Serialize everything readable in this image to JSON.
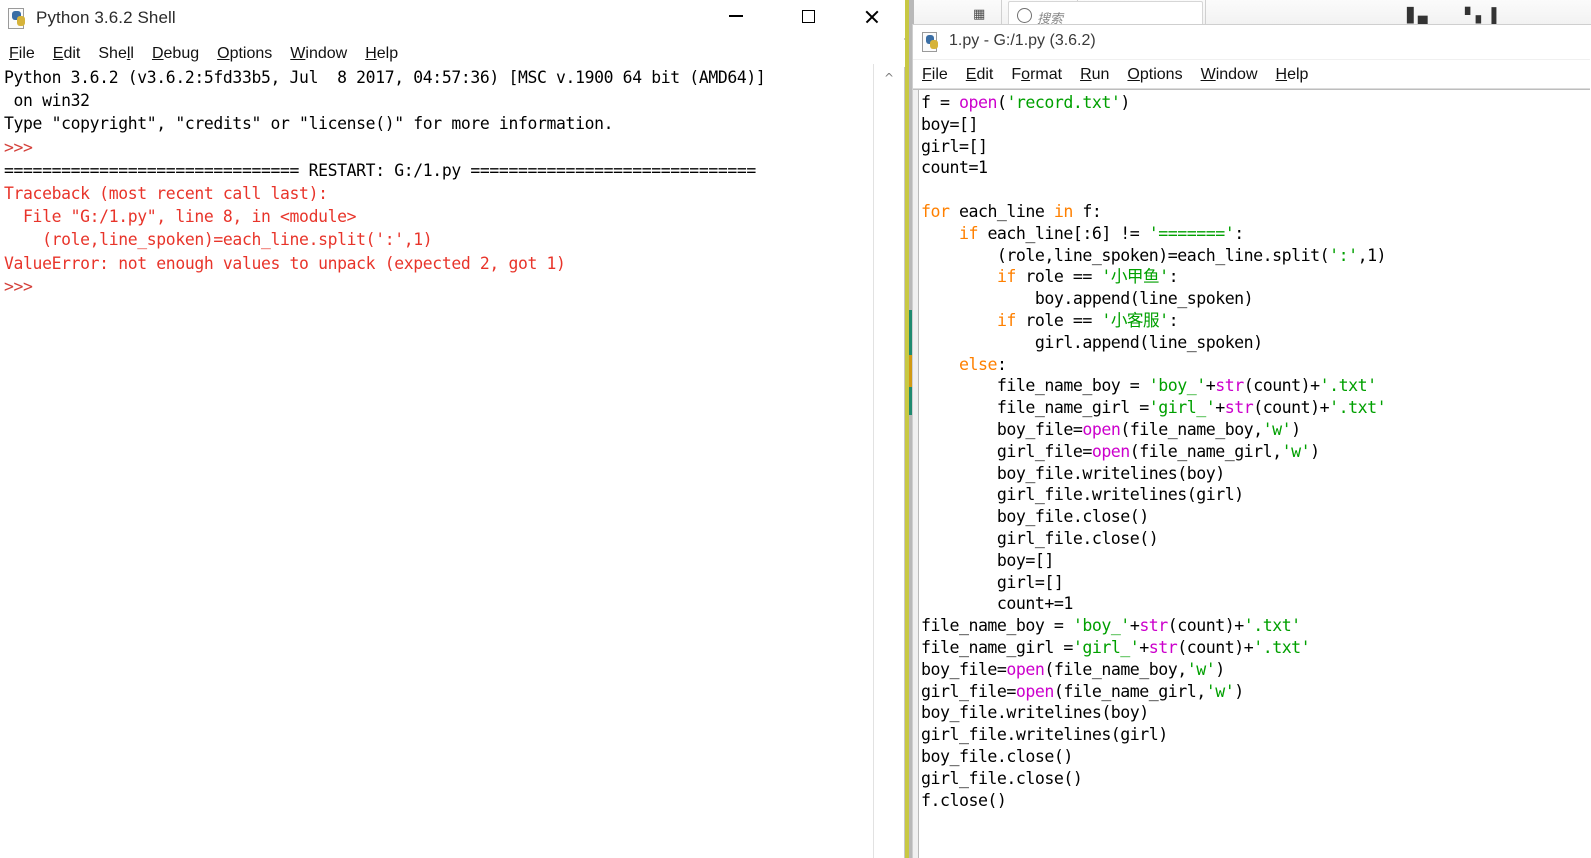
{
  "background_window": {
    "search_placeholder": "搜索",
    "icons": [
      "calculator-icon",
      "ellipsis-icon",
      "person-icon",
      "search-icon",
      "chart-icon",
      "bars-icon"
    ]
  },
  "shell_window": {
    "title": "Python 3.6.2 Shell",
    "app_icon": "python-icon",
    "window_buttons": {
      "minimize": "minimize-icon",
      "maximize": "maximize-icon",
      "close": "close-icon"
    },
    "menu": [
      {
        "label": "File",
        "mnemonic": "F"
      },
      {
        "label": "Edit",
        "mnemonic": "E"
      },
      {
        "label": "Shell",
        "mnemonic": "l"
      },
      {
        "label": "Debug",
        "mnemonic": "D"
      },
      {
        "label": "Options",
        "mnemonic": "O"
      },
      {
        "label": "Window",
        "mnemonic": "W"
      },
      {
        "label": "Help",
        "mnemonic": "H"
      }
    ],
    "scrollbar": {
      "up_arrow": "chevron-up-icon"
    },
    "output_lines": [
      {
        "text": "Python 3.6.2 (v3.6.2:5fd33b5, Jul  8 2017, 04:57:36) [MSC v.1900 64 bit (AMD64)]",
        "style": "plain"
      },
      {
        "text": " on win32",
        "style": "plain"
      },
      {
        "text": "Type \"copyright\", \"credits\" or \"license()\" for more information.",
        "style": "plain"
      },
      {
        "text": ">>>",
        "style": "prompt"
      },
      {
        "text": "=============================== RESTART: G:/1.py ==============================",
        "style": "plain"
      },
      {
        "text": "Traceback (most recent call last):",
        "style": "error"
      },
      {
        "text": "  File \"G:/1.py\", line 8, in <module>",
        "style": "error"
      },
      {
        "text": "    (role,line_spoken)=each_line.split(':',1)",
        "style": "error"
      },
      {
        "text": "ValueError: not enough values to unpack (expected 2, got 1)",
        "style": "error"
      },
      {
        "text": ">>>",
        "style": "prompt"
      }
    ]
  },
  "editor_window": {
    "title": "1.py - G:/1.py (3.6.2)",
    "app_icon": "python-icon",
    "menu": [
      {
        "label": "File",
        "mnemonic": "F"
      },
      {
        "label": "Edit",
        "mnemonic": "E"
      },
      {
        "label": "Format",
        "mnemonic": "o"
      },
      {
        "label": "Run",
        "mnemonic": "R"
      },
      {
        "label": "Options",
        "mnemonic": "O"
      },
      {
        "label": "Window",
        "mnemonic": "W"
      },
      {
        "label": "Help",
        "mnemonic": "H"
      }
    ],
    "code_lines": [
      [
        {
          "t": "f = ",
          "c": ""
        },
        {
          "t": "open",
          "c": "b"
        },
        {
          "t": "(",
          "c": ""
        },
        {
          "t": "'record.txt'",
          "c": "s"
        },
        {
          "t": ")",
          "c": ""
        }
      ],
      [
        {
          "t": "boy=[]",
          "c": ""
        }
      ],
      [
        {
          "t": "girl=[]",
          "c": ""
        }
      ],
      [
        {
          "t": "count=1",
          "c": ""
        }
      ],
      [
        {
          "t": "",
          "c": ""
        }
      ],
      [
        {
          "t": "for",
          "c": "k"
        },
        {
          "t": " each_line ",
          "c": ""
        },
        {
          "t": "in",
          "c": "k"
        },
        {
          "t": " f:",
          "c": ""
        }
      ],
      [
        {
          "t": "    ",
          "c": ""
        },
        {
          "t": "if",
          "c": "k"
        },
        {
          "t": " each_line[:6] != ",
          "c": ""
        },
        {
          "t": "'======='",
          "c": "s"
        },
        {
          "t": ":",
          "c": ""
        }
      ],
      [
        {
          "t": "        (role,line_spoken)=each_line.split(",
          "c": ""
        },
        {
          "t": "':'",
          "c": "s"
        },
        {
          "t": ",1)",
          "c": ""
        }
      ],
      [
        {
          "t": "        ",
          "c": ""
        },
        {
          "t": "if",
          "c": "k"
        },
        {
          "t": " role == ",
          "c": ""
        },
        {
          "t": "'小甲鱼'",
          "c": "s"
        },
        {
          "t": ":",
          "c": ""
        }
      ],
      [
        {
          "t": "            boy.append(line_spoken)",
          "c": ""
        }
      ],
      [
        {
          "t": "        ",
          "c": ""
        },
        {
          "t": "if",
          "c": "k"
        },
        {
          "t": " role == ",
          "c": ""
        },
        {
          "t": "'小客服'",
          "c": "s"
        },
        {
          "t": ":",
          "c": ""
        }
      ],
      [
        {
          "t": "            girl.append(line_spoken)",
          "c": ""
        }
      ],
      [
        {
          "t": "    ",
          "c": ""
        },
        {
          "t": "else",
          "c": "k"
        },
        {
          "t": ":",
          "c": ""
        }
      ],
      [
        {
          "t": "        file_name_boy = ",
          "c": ""
        },
        {
          "t": "'boy_'",
          "c": "s"
        },
        {
          "t": "+",
          "c": ""
        },
        {
          "t": "str",
          "c": "b"
        },
        {
          "t": "(count)+",
          "c": ""
        },
        {
          "t": "'.txt'",
          "c": "s"
        }
      ],
      [
        {
          "t": "        file_name_girl =",
          "c": ""
        },
        {
          "t": "'girl_'",
          "c": "s"
        },
        {
          "t": "+",
          "c": ""
        },
        {
          "t": "str",
          "c": "b"
        },
        {
          "t": "(count)+",
          "c": ""
        },
        {
          "t": "'.txt'",
          "c": "s"
        }
      ],
      [
        {
          "t": "        boy_file=",
          "c": ""
        },
        {
          "t": "open",
          "c": "b"
        },
        {
          "t": "(file_name_boy,",
          "c": ""
        },
        {
          "t": "'w'",
          "c": "s"
        },
        {
          "t": ")",
          "c": ""
        }
      ],
      [
        {
          "t": "        girl_file=",
          "c": ""
        },
        {
          "t": "open",
          "c": "b"
        },
        {
          "t": "(file_name_girl,",
          "c": ""
        },
        {
          "t": "'w'",
          "c": "s"
        },
        {
          "t": ")",
          "c": ""
        }
      ],
      [
        {
          "t": "        boy_file.writelines(boy)",
          "c": ""
        }
      ],
      [
        {
          "t": "        girl_file.writelines(girl)",
          "c": ""
        }
      ],
      [
        {
          "t": "        boy_file.close()",
          "c": ""
        }
      ],
      [
        {
          "t": "        girl_file.close()",
          "c": ""
        }
      ],
      [
        {
          "t": "        boy=[]",
          "c": ""
        }
      ],
      [
        {
          "t": "        girl=[]",
          "c": ""
        }
      ],
      [
        {
          "t": "        count+=1",
          "c": ""
        }
      ],
      [
        {
          "t": "file_name_boy = ",
          "c": ""
        },
        {
          "t": "'boy_'",
          "c": "s"
        },
        {
          "t": "+",
          "c": ""
        },
        {
          "t": "str",
          "c": "b"
        },
        {
          "t": "(count)+",
          "c": ""
        },
        {
          "t": "'.txt'",
          "c": "s"
        }
      ],
      [
        {
          "t": "file_name_girl =",
          "c": ""
        },
        {
          "t": "'girl_'",
          "c": "s"
        },
        {
          "t": "+",
          "c": ""
        },
        {
          "t": "str",
          "c": "b"
        },
        {
          "t": "(count)+",
          "c": ""
        },
        {
          "t": "'.txt'",
          "c": "s"
        }
      ],
      [
        {
          "t": "boy_file=",
          "c": ""
        },
        {
          "t": "open",
          "c": "b"
        },
        {
          "t": "(file_name_boy,",
          "c": ""
        },
        {
          "t": "'w'",
          "c": "s"
        },
        {
          "t": ")",
          "c": ""
        }
      ],
      [
        {
          "t": "girl_file=",
          "c": ""
        },
        {
          "t": "open",
          "c": "b"
        },
        {
          "t": "(file_name_girl,",
          "c": ""
        },
        {
          "t": "'w'",
          "c": "s"
        },
        {
          "t": ")",
          "c": ""
        }
      ],
      [
        {
          "t": "boy_file.writelines(boy)",
          "c": ""
        }
      ],
      [
        {
          "t": "girl_file.writelines(girl)",
          "c": ""
        }
      ],
      [
        {
          "t": "boy_file.close()",
          "c": ""
        }
      ],
      [
        {
          "t": "girl_file.close()",
          "c": ""
        }
      ],
      [
        {
          "t": "f.close()",
          "c": ""
        }
      ]
    ]
  },
  "colors": {
    "keyword": "#ff8000",
    "builtin": "#cc00cc",
    "string": "#00a000",
    "error": "#e8342a",
    "prompt": "#d4403a",
    "rail_yellow": "#c8c843",
    "rail_green": "#1f8a70",
    "rail_orange": "#d19a14"
  }
}
